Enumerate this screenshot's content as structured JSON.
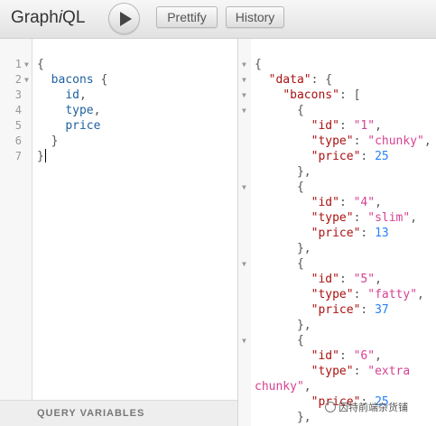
{
  "app": {
    "logo_prefix": "Graph",
    "logo_i": "i",
    "logo_suffix": "QL"
  },
  "toolbar": {
    "run_label": "Execute query",
    "prettify_label": "Prettify",
    "history_label": "History"
  },
  "editor": {
    "lines": [
      {
        "num": "1",
        "fold": "▼",
        "text": "{"
      },
      {
        "num": "2",
        "fold": "▼",
        "text": "  bacons {"
      },
      {
        "num": "3",
        "fold": "",
        "text": "    id,"
      },
      {
        "num": "4",
        "fold": "",
        "text": "    type,"
      },
      {
        "num": "5",
        "fold": "",
        "text": "    price"
      },
      {
        "num": "6",
        "fold": "",
        "text": "  }"
      },
      {
        "num": "7",
        "fold": "",
        "text": "}"
      }
    ],
    "query_variables_label": "QUERY VARIABLES"
  },
  "result": {
    "lines": [
      {
        "fold": "▼",
        "indent": 0,
        "parts": [
          [
            "p",
            "{"
          ]
        ]
      },
      {
        "fold": "▼",
        "indent": 1,
        "parts": [
          [
            "k",
            "\"data\""
          ],
          [
            "p",
            ": {"
          ]
        ]
      },
      {
        "fold": "▼",
        "indent": 2,
        "parts": [
          [
            "k",
            "\"bacons\""
          ],
          [
            "p",
            ": ["
          ]
        ]
      },
      {
        "fold": "▼",
        "indent": 3,
        "parts": [
          [
            "p",
            "{"
          ]
        ]
      },
      {
        "fold": "",
        "indent": 4,
        "parts": [
          [
            "k",
            "\"id\""
          ],
          [
            "p",
            ": "
          ],
          [
            "s",
            "\"1\""
          ],
          [
            "p",
            ","
          ]
        ]
      },
      {
        "fold": "",
        "indent": 4,
        "parts": [
          [
            "k",
            "\"type\""
          ],
          [
            "p",
            ": "
          ],
          [
            "s",
            "\"chunky\""
          ],
          [
            "p",
            ","
          ]
        ]
      },
      {
        "fold": "",
        "indent": 4,
        "parts": [
          [
            "k",
            "\"price\""
          ],
          [
            "p",
            ": "
          ],
          [
            "n",
            "25"
          ]
        ]
      },
      {
        "fold": "",
        "indent": 3,
        "parts": [
          [
            "p",
            "},"
          ]
        ]
      },
      {
        "fold": "▼",
        "indent": 3,
        "parts": [
          [
            "p",
            "{"
          ]
        ]
      },
      {
        "fold": "",
        "indent": 4,
        "parts": [
          [
            "k",
            "\"id\""
          ],
          [
            "p",
            ": "
          ],
          [
            "s",
            "\"4\""
          ],
          [
            "p",
            ","
          ]
        ]
      },
      {
        "fold": "",
        "indent": 4,
        "parts": [
          [
            "k",
            "\"type\""
          ],
          [
            "p",
            ": "
          ],
          [
            "s",
            "\"slim\""
          ],
          [
            "p",
            ","
          ]
        ]
      },
      {
        "fold": "",
        "indent": 4,
        "parts": [
          [
            "k",
            "\"price\""
          ],
          [
            "p",
            ": "
          ],
          [
            "n",
            "13"
          ]
        ]
      },
      {
        "fold": "",
        "indent": 3,
        "parts": [
          [
            "p",
            "},"
          ]
        ]
      },
      {
        "fold": "▼",
        "indent": 3,
        "parts": [
          [
            "p",
            "{"
          ]
        ]
      },
      {
        "fold": "",
        "indent": 4,
        "parts": [
          [
            "k",
            "\"id\""
          ],
          [
            "p",
            ": "
          ],
          [
            "s",
            "\"5\""
          ],
          [
            "p",
            ","
          ]
        ]
      },
      {
        "fold": "",
        "indent": 4,
        "parts": [
          [
            "k",
            "\"type\""
          ],
          [
            "p",
            ": "
          ],
          [
            "s",
            "\"fatty\""
          ],
          [
            "p",
            ","
          ]
        ]
      },
      {
        "fold": "",
        "indent": 4,
        "parts": [
          [
            "k",
            "\"price\""
          ],
          [
            "p",
            ": "
          ],
          [
            "n",
            "37"
          ]
        ]
      },
      {
        "fold": "",
        "indent": 3,
        "parts": [
          [
            "p",
            "},"
          ]
        ]
      },
      {
        "fold": "▼",
        "indent": 3,
        "parts": [
          [
            "p",
            "{"
          ]
        ]
      },
      {
        "fold": "",
        "indent": 4,
        "parts": [
          [
            "k",
            "\"id\""
          ],
          [
            "p",
            ": "
          ],
          [
            "s",
            "\"6\""
          ],
          [
            "p",
            ","
          ]
        ]
      },
      {
        "fold": "",
        "indent": 4,
        "parts": [
          [
            "k",
            "\"type\""
          ],
          [
            "p",
            ": "
          ],
          [
            "s",
            "\"extra"
          ]
        ]
      },
      {
        "fold": "",
        "indent": 0,
        "parts": [
          [
            "s",
            "chunky\""
          ],
          [
            "p",
            ","
          ]
        ]
      },
      {
        "fold": "",
        "indent": 4,
        "parts": [
          [
            "k",
            "\"price\""
          ],
          [
            "p",
            ": "
          ],
          [
            "n",
            "25"
          ]
        ]
      },
      {
        "fold": "",
        "indent": 3,
        "parts": [
          [
            "p",
            "},"
          ]
        ]
      }
    ]
  },
  "watermark": {
    "text": "因特前端杂货铺"
  },
  "colors": {
    "key": "#aa1111",
    "string": "#d64292",
    "number": "#2882f9"
  }
}
